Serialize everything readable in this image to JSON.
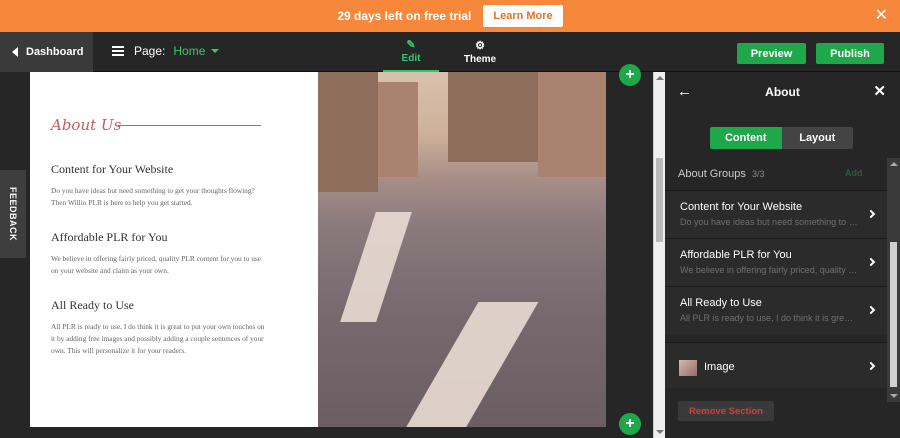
{
  "banner": {
    "message": "29 days left on free trial",
    "cta": "Learn More",
    "close": "✕"
  },
  "toolbar": {
    "dashboard_label": "Dashboard",
    "page_label": "Page:",
    "page_value": "Home",
    "tabs": [
      {
        "label": "Edit",
        "icon": "✎",
        "active": true
      },
      {
        "label": "Theme",
        "icon": "⚙"
      }
    ],
    "preview_label": "Preview",
    "publish_label": "Publish"
  },
  "feedback_label": "FEEDBACK",
  "preview": {
    "section_title": "About Us",
    "items": [
      {
        "title": "Content for Your Website",
        "desc": "Do you have ideas but need something to get your thoughts flowing? Then Willio PLR is here to help you get started."
      },
      {
        "title": "Affordable PLR for You",
        "desc": "We believe in offering fairly priced, quality PLR content for you to use on your website and claim as your own."
      },
      {
        "title": "All Ready to Use",
        "desc": "All PLR is ready to use, I do think it is great to put your own touches on it by adding free images and possibly adding a couple sentences of your own. This will personalize it for your readers."
      }
    ],
    "plus": "+"
  },
  "panel": {
    "title": "About",
    "back": "←",
    "close": "✕",
    "seg_content": "Content",
    "seg_layout": "Layout",
    "groups_label": "About Groups",
    "groups_count": "3/3",
    "add_label": "Add",
    "groups": [
      {
        "title": "Content for Your Website",
        "sub": "Do you have ideas but need something to get your thoughts flowing?"
      },
      {
        "title": "Affordable PLR for You",
        "sub": "We believe in offering fairly priced, quality PLR content for you to use"
      },
      {
        "title": "All Ready to Use",
        "sub": "All PLR is ready to use, I do think it is great to put your own touches"
      }
    ],
    "image_label": "Image",
    "remove_label": "Remove Section"
  },
  "colors": {
    "banner": "#f7873a",
    "accent_green": "#1fa84a",
    "title_rose": "#c75b63"
  }
}
